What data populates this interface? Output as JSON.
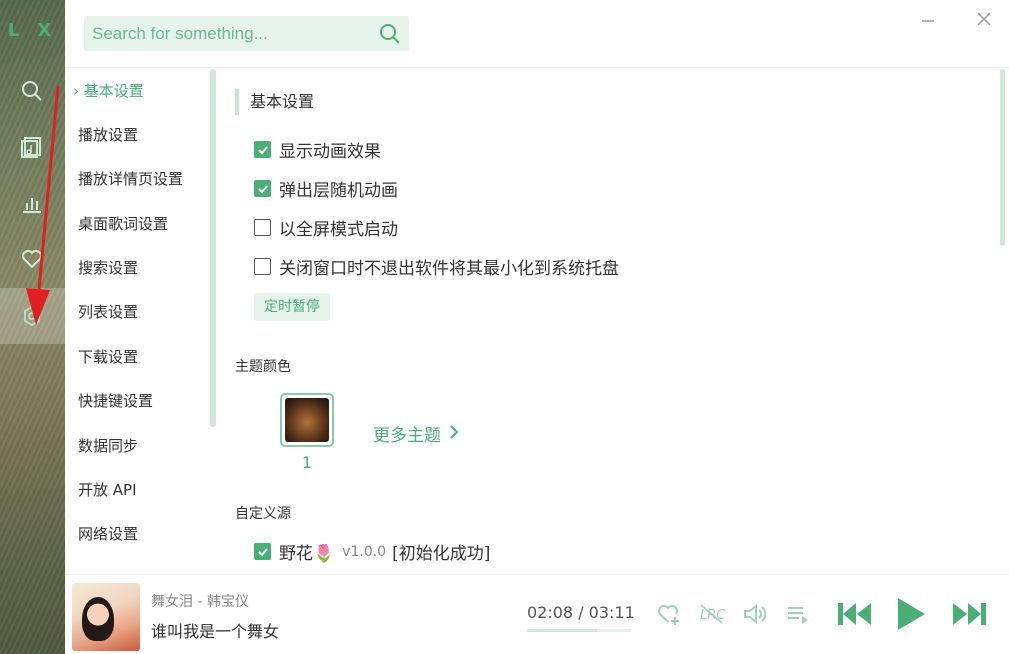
{
  "app": {
    "logo": "L X"
  },
  "search": {
    "placeholder": "Search for something..."
  },
  "settings_nav": {
    "items": [
      {
        "label": "基本设置",
        "active": true
      },
      {
        "label": "播放设置"
      },
      {
        "label": "播放详情页设置"
      },
      {
        "label": "桌面歌词设置"
      },
      {
        "label": "搜索设置"
      },
      {
        "label": "列表设置"
      },
      {
        "label": "下载设置"
      },
      {
        "label": "快捷键设置"
      },
      {
        "label": "数据同步"
      },
      {
        "label": "开放 API"
      },
      {
        "label": "网络设置"
      }
    ]
  },
  "basic": {
    "title": "基本设置",
    "options": [
      {
        "label": "显示动画效果",
        "checked": true
      },
      {
        "label": "弹出层随机动画",
        "checked": true
      },
      {
        "label": "以全屏模式启动",
        "checked": false
      },
      {
        "label": "关闭窗口时不退出软件将其最小化到系统托盘",
        "checked": false
      }
    ],
    "timer_button": "定时暂停"
  },
  "theme": {
    "title": "主题颜色",
    "items": [
      {
        "name": "1"
      }
    ],
    "more_label": "更多主题"
  },
  "custom_source": {
    "title": "自定义源",
    "items": [
      {
        "name": "野花🌷",
        "version": "v1.0.0",
        "status": "[初始化成功]",
        "checked": true
      }
    ]
  },
  "player": {
    "song_title": "舞女泪 - 韩宝仪",
    "lyric": "谁叫我是一个舞女",
    "time": "02:08 / 03:11",
    "progress": 0.67
  },
  "colors": {
    "accent": "#4cae77",
    "accent_light": "#e5f3ea",
    "annotation": "#e02020"
  }
}
